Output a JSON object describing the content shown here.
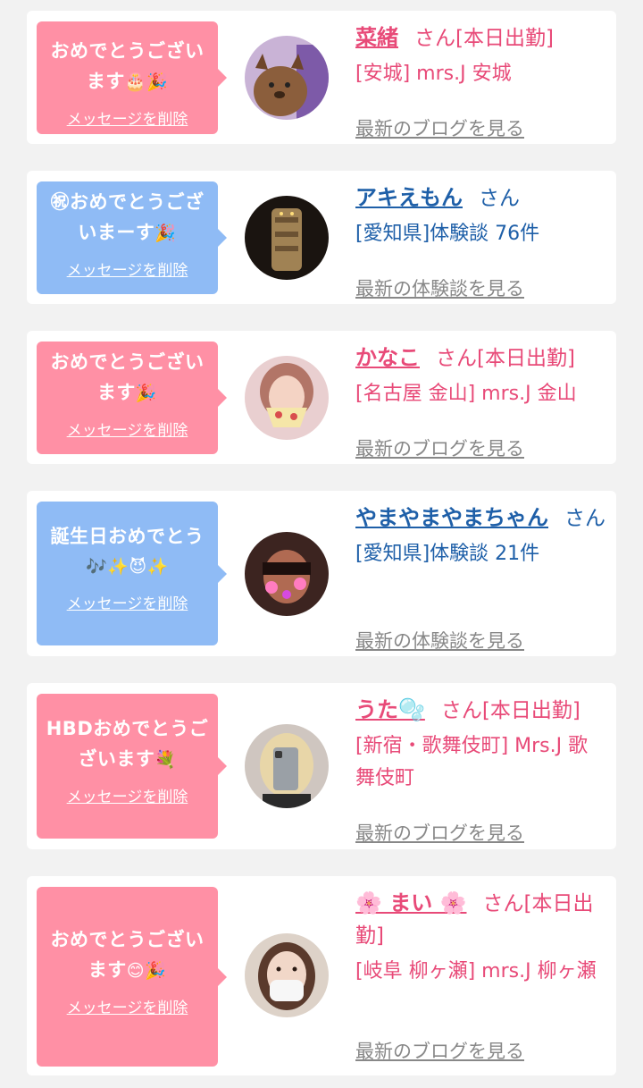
{
  "cards": [
    {
      "theme": "pink",
      "message": "おめでとうございます",
      "emoji": "🎂🎉",
      "delete_label": "メッセージを削除",
      "name": "菜緒",
      "san": "さん[本日出勤]",
      "shop": "[安城] mrs.J 安城",
      "more": "最新のブログを見る"
    },
    {
      "theme": "blue",
      "message": "㊗おめでとうございまーす",
      "emoji": "🎉",
      "delete_label": "メッセージを削除",
      "name": "アキえもん",
      "san": "さん",
      "shop": "[愛知県]体験談 76件",
      "more": "最新の体験談を見る"
    },
    {
      "theme": "pink",
      "message": "おめでとうございます",
      "emoji": "🎉",
      "delete_label": "メッセージを削除",
      "name": "かなこ",
      "san": "さん[本日出勤]",
      "shop": "[名古屋 金山] mrs.J 金山",
      "more": "最新のブログを見る"
    },
    {
      "theme": "blue",
      "message": "誕生日おめでとう",
      "emoji": "🎶✨😈✨",
      "delete_label": "メッセージを削除",
      "name": "やまやまやまちゃん",
      "san": "さん",
      "shop": "[愛知県]体験談 21件",
      "more": "最新の体験談を見る"
    },
    {
      "theme": "pink",
      "message": "HBDおめでとうございます",
      "emoji": "💐",
      "delete_label": "メッセージを削除",
      "name": "うた🫧",
      "san": "さん[本日出勤]",
      "shop": "[新宿・歌舞伎町] Mrs.J 歌舞伎町",
      "more": "最新のブログを見る"
    },
    {
      "theme": "pink",
      "message": "おめでとうございます",
      "emoji": "😊🎉",
      "delete_label": "メッセージを削除",
      "name": "🌸 まい 🌸",
      "san": "さん[本日出勤]",
      "shop": "[岐阜 柳ヶ瀬] mrs.J 柳ヶ瀬",
      "more": "最新のブログを見る"
    }
  ]
}
